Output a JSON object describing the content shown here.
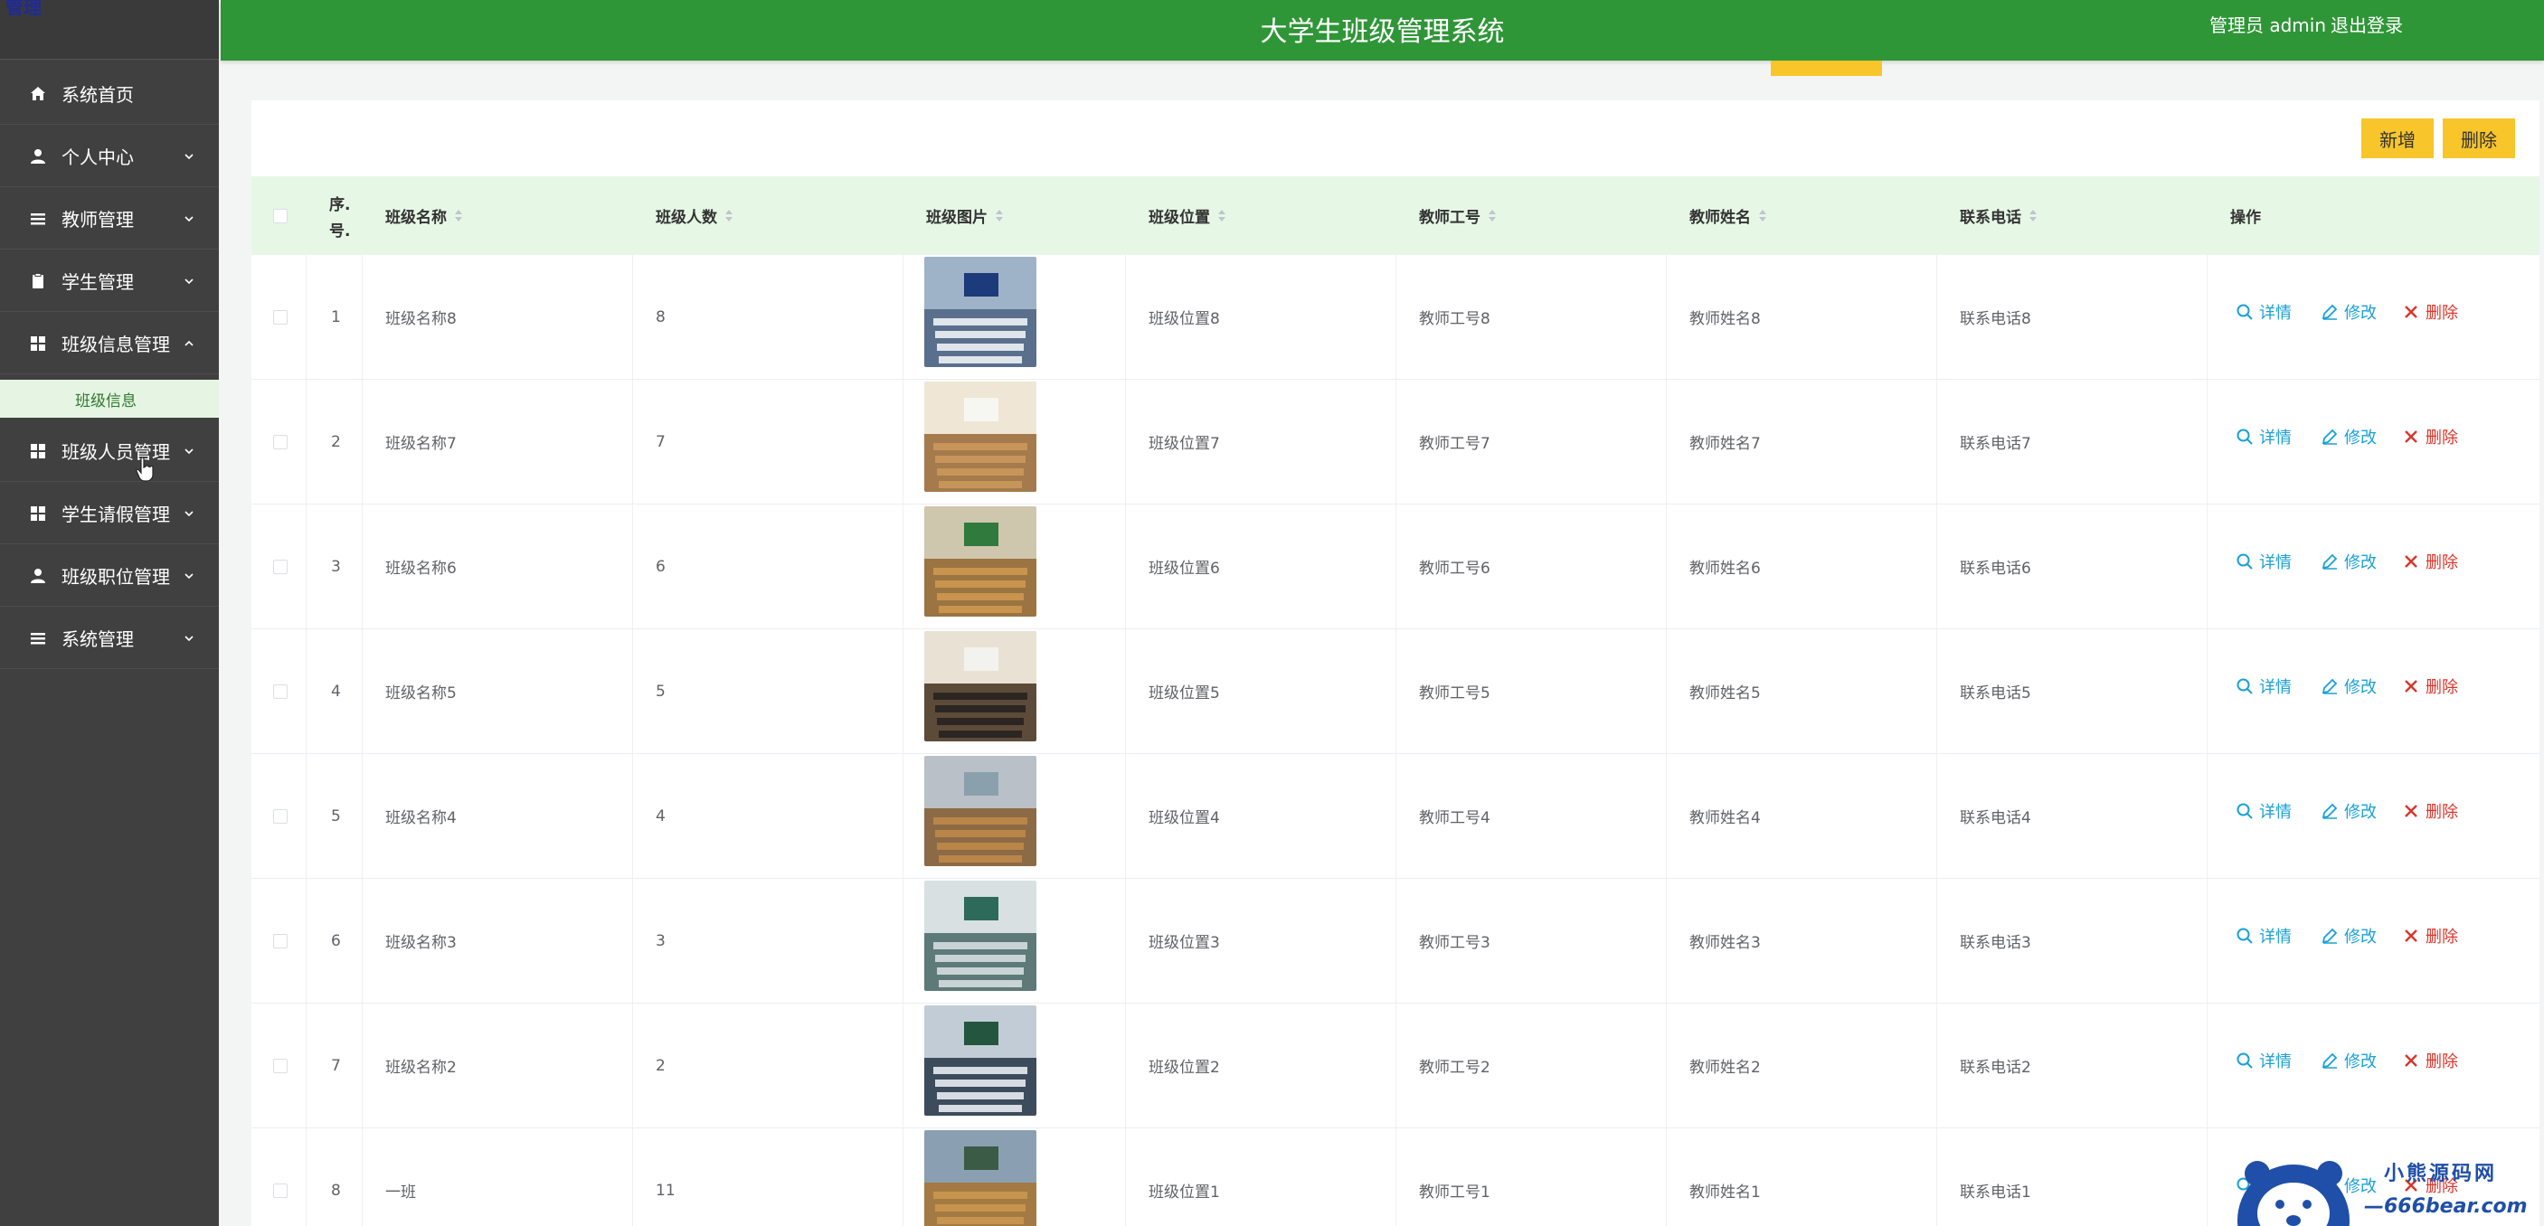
{
  "app": {
    "title": "大学生班级管理系统",
    "user": "管理员 admin",
    "logout": "退出登录",
    "logo_fragment": "管理"
  },
  "sidebar": {
    "items": [
      {
        "label": "系统首页",
        "icon": "home-icon",
        "expandable": false
      },
      {
        "label": "个人中心",
        "icon": "user-icon",
        "expandable": true
      },
      {
        "label": "教师管理",
        "icon": "list-icon",
        "expandable": true
      },
      {
        "label": "学生管理",
        "icon": "clipboard-icon",
        "expandable": true
      },
      {
        "label": "班级信息管理",
        "icon": "grid-icon",
        "expandable": true,
        "expanded": true
      },
      {
        "label": "班级人员管理",
        "icon": "grid-icon",
        "expandable": true
      },
      {
        "label": "学生请假管理",
        "icon": "grid-icon",
        "expandable": true
      },
      {
        "label": "班级职位管理",
        "icon": "user-icon",
        "expandable": true
      },
      {
        "label": "系统管理",
        "icon": "list-icon",
        "expandable": true
      }
    ],
    "submenu": {
      "label": "班级信息",
      "active": true
    }
  },
  "toolbar": {
    "add_label": "新增",
    "delete_label": "删除"
  },
  "table": {
    "columns": [
      "序号",
      "班级名称",
      "班级人数",
      "班级图片",
      "班级位置",
      "教师工号",
      "教师姓名",
      "联系电话",
      "操作"
    ],
    "index_header_line1": "序.",
    "index_header_line2": "号.",
    "actions": {
      "detail": "详情",
      "edit": "修改",
      "delete": "删除"
    },
    "rows": [
      {
        "index": "1",
        "name": "班级名称8",
        "count": "8",
        "location": "班级位置8",
        "teacher_id": "教师工号8",
        "teacher_name": "教师姓名8",
        "phone": "联系电话8"
      },
      {
        "index": "2",
        "name": "班级名称7",
        "count": "7",
        "location": "班级位置7",
        "teacher_id": "教师工号7",
        "teacher_name": "教师姓名7",
        "phone": "联系电话7"
      },
      {
        "index": "3",
        "name": "班级名称6",
        "count": "6",
        "location": "班级位置6",
        "teacher_id": "教师工号6",
        "teacher_name": "教师姓名6",
        "phone": "联系电话6"
      },
      {
        "index": "4",
        "name": "班级名称5",
        "count": "5",
        "location": "班级位置5",
        "teacher_id": "教师工号5",
        "teacher_name": "教师姓名5",
        "phone": "联系电话5"
      },
      {
        "index": "5",
        "name": "班级名称4",
        "count": "4",
        "location": "班级位置4",
        "teacher_id": "教师工号4",
        "teacher_name": "教师姓名4",
        "phone": "联系电话4"
      },
      {
        "index": "6",
        "name": "班级名称3",
        "count": "3",
        "location": "班级位置3",
        "teacher_id": "教师工号3",
        "teacher_name": "教师姓名3",
        "phone": "联系电话3"
      },
      {
        "index": "7",
        "name": "班级名称2",
        "count": "2",
        "location": "班级位置2",
        "teacher_id": "教师工号2",
        "teacher_name": "教师姓名2",
        "phone": "联系电话2"
      },
      {
        "index": "8",
        "name": "一班",
        "count": "11",
        "location": "班级位置1",
        "teacher_id": "教师工号1",
        "teacher_name": "教师姓名1",
        "phone": "联系电话1"
      }
    ]
  },
  "watermark": {
    "line1": "小熊源码网",
    "line2": "—666bear.com—"
  },
  "colors": {
    "header": "#2f9637",
    "sidebar": "#404040",
    "accent": "#f8c52b",
    "table_header": "#e6f7e6",
    "link": "#1aa1d6",
    "danger": "#d9352b"
  }
}
